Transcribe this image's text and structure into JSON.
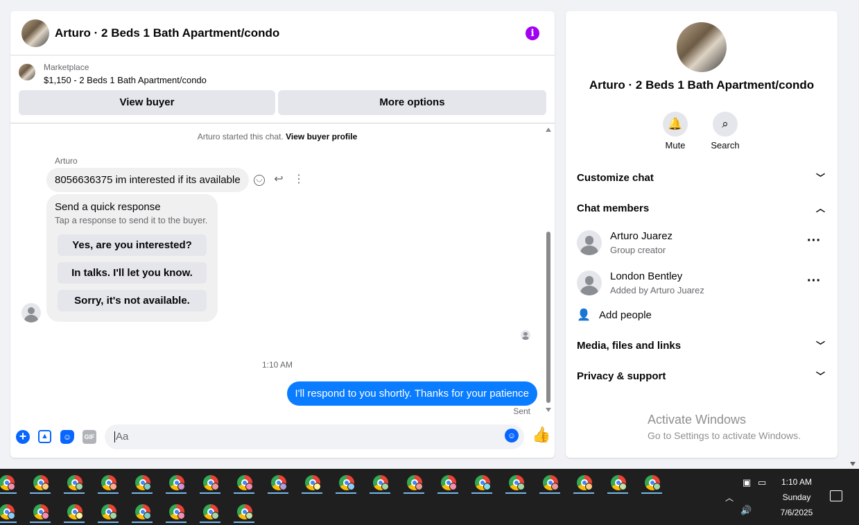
{
  "chat": {
    "title": "Arturo · 2 Beds 1 Bath Apartment/condo",
    "listing": {
      "category": "Marketplace",
      "summary": "$1,150 - 2 Beds 1 Bath Apartment/condo",
      "view_buyer_label": "View buyer",
      "more_options_label": "More options"
    },
    "started_text": "Arturo started this chat.",
    "view_buyer_profile_link": "View buyer profile",
    "sender_name": "Arturo",
    "incoming_message": "8056636375 im interested if its available",
    "quick_response": {
      "title": "Send a quick response",
      "subtitle": "Tap a response to send it to the buyer.",
      "options": [
        "Yes, are you interested?",
        "In talks. I'll let you know.",
        "Sorry, it's not available."
      ]
    },
    "timestamp": "1:10 AM",
    "outgoing_message": "I'll respond to you shortly. Thanks for your patience",
    "outgoing_status": "Sent",
    "composer": {
      "placeholder": "Aa",
      "gif_label": "GIF"
    }
  },
  "details": {
    "title": "Arturo · 2 Beds 1 Bath Apartment/condo",
    "actions": [
      {
        "label": "Mute",
        "icon": "bell-icon"
      },
      {
        "label": "Search",
        "icon": "search-icon"
      }
    ],
    "sections": {
      "customize": "Customize chat",
      "members": "Chat members",
      "media": "Media, files and links",
      "privacy": "Privacy & support"
    },
    "members": [
      {
        "name": "Arturo Juarez",
        "role": "Group creator"
      },
      {
        "name": "London Bentley",
        "role": "Added by Arturo Juarez"
      }
    ],
    "add_people_label": "Add people"
  },
  "watermark": {
    "title": "Activate Windows",
    "subtitle": "Go to Settings to activate Windows."
  },
  "taskbar": {
    "time": "1:10 AM",
    "day": "Sunday",
    "date": "7/6/2025",
    "app_icon": "chrome-profile-icon",
    "row1_badges": [
      "#f48fb1",
      "#ffcc80",
      "#a5d6a7",
      "#ffab91",
      "#80cbc4",
      "#ce93d8",
      "#ef9a9a",
      "#f48fb1",
      "#b39ddb",
      "#fff59d",
      "#90caf9",
      "#a5d6a7",
      "#ef9a9a",
      "#f48fb1",
      "#80deea",
      "#a5d6a7",
      "#ef9a9a",
      "#ffcc80",
      "#c5e1a5",
      "#a5d6a7"
    ],
    "row2_badges": [
      "#90caf9",
      "#f48fb1",
      "#fff59d",
      "#a5d6a7",
      "#80cbc4",
      "#f48fb1",
      "#a5d6a7",
      "#c5e1a5"
    ]
  },
  "colors": {
    "accent": "#0866ff",
    "outgoing_bubble": "#0a7cff",
    "info": "#a100f2"
  }
}
